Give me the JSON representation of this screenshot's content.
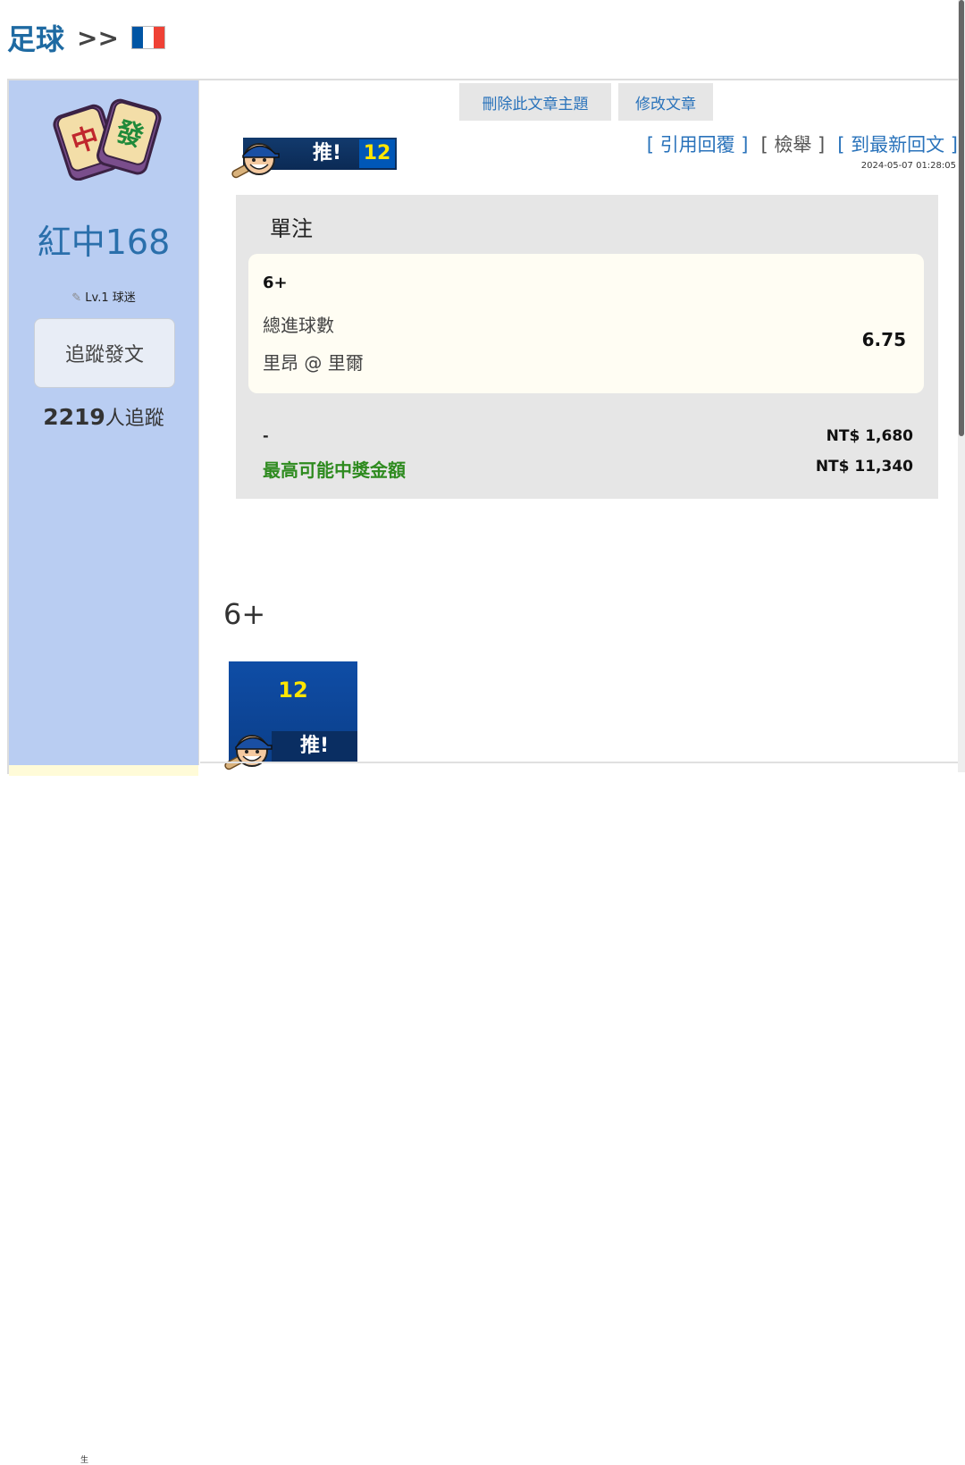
{
  "header": {
    "sport": "足球",
    "separator": ">>",
    "flag_icon": "france-flag-icon",
    "flag_colors": [
      "#0055a4",
      "#ffffff",
      "#ef4135"
    ]
  },
  "sidebar": {
    "avatar_icon": "mahjong-tiles-icon",
    "username": "紅中168",
    "level_icon": "pencil-icon",
    "level": "Lv.1 球迷",
    "follow_button": "追蹤發文",
    "followers_count": "2219",
    "followers_suffix": "人追蹤",
    "footer_text": "生"
  },
  "post": {
    "actions": {
      "delete": "刪除此文章主題",
      "edit": "修改文章"
    },
    "push_badge": {
      "label": "推!",
      "count": "12"
    },
    "links": {
      "quote": "[ 引用回覆 ]",
      "report": "[ 檢舉 ]",
      "latest": "[ 到最新回文 ]"
    },
    "timestamp": "2024-05-07 01:28:05",
    "bet_slip": {
      "title": "單注",
      "pick": "6+",
      "market": "總進球數",
      "match": "里昂 @ 里爾",
      "odds": "6.75",
      "stake_label": "-",
      "stake_value": "NT$ 1,680",
      "max_prize_label": "最高可能中獎金額",
      "max_prize_value": "NT$ 11,340"
    },
    "body_text": "6+",
    "push_box": {
      "count": "12",
      "label": "推!"
    }
  },
  "colors": {
    "sidebar_bg": "#b9cdf2",
    "link_blue": "#2a73bb",
    "prize_green": "#2e8b1f",
    "badge_navy": "#0b2a55",
    "badge_yellow": "#ffe600"
  }
}
